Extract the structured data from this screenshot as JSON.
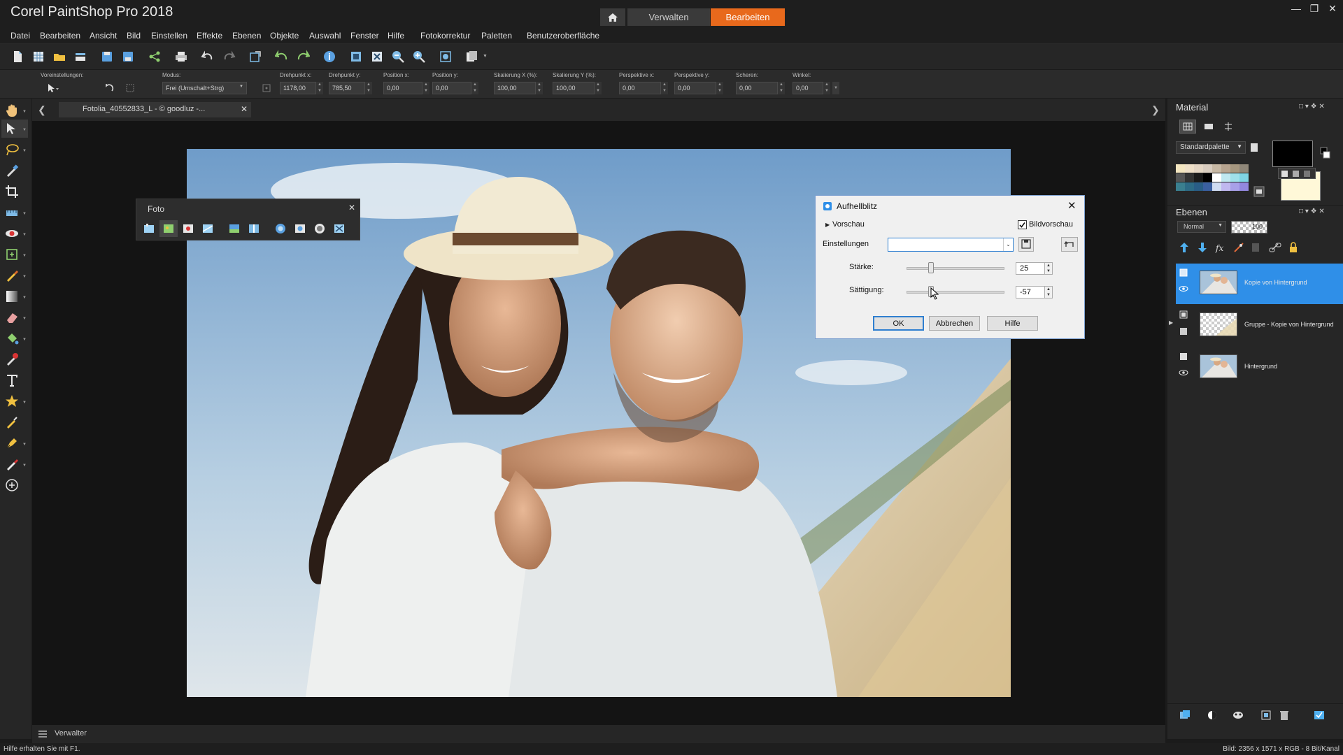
{
  "app": {
    "title": "Corel PaintShop Pro 2018",
    "tabs": {
      "manage": "Verwalten",
      "edit": "Bearbeiten"
    }
  },
  "menu": [
    "Datei",
    "Bearbeiten",
    "Ansicht",
    "Bild",
    "Einstellen",
    "Effekte",
    "Ebenen",
    "Objekte",
    "Auswahl",
    "Fenster",
    "Hilfe",
    "Fotokorrektur",
    "Paletten",
    "Benutzeroberfläche"
  ],
  "options": {
    "presets_label": "Voreinstellungen:",
    "mode_label": "Modus:",
    "mode_value": "Frei (Umschalt+Strg)",
    "pivot_x_label": "Drehpunkt x:",
    "pivot_x_value": "1178,00",
    "pivot_y_label": "Drehpunkt y:",
    "pivot_y_value": "785,50",
    "pos_x_label": "Position x:",
    "pos_x_value": "0,00",
    "pos_y_label": "Position y:",
    "pos_y_value": "0,00",
    "scale_x_label": "Skalierung X (%):",
    "scale_x_value": "100,00",
    "scale_y_label": "Skalierung Y (%):",
    "scale_y_value": "100,00",
    "persp_x_label": "Perspektive x:",
    "persp_x_value": "0,00",
    "persp_y_label": "Perspektive y:",
    "persp_y_value": "0,00",
    "shear_label": "Scheren:",
    "shear_value": "0,00",
    "angle_label": "Winkel:",
    "angle_value": "0,00"
  },
  "document": {
    "tab_title": "Fotolia_40552833_L - © goodluz -..."
  },
  "foto_palette": {
    "title": "Foto"
  },
  "dialog": {
    "title": "Aufhellblitz",
    "preview_label": "Vorschau",
    "image_preview_label": "Bildvorschau",
    "image_preview_checked": true,
    "settings_label": "Einstellungen",
    "settings_value": "",
    "strength_label": "Stärke:",
    "strength_value": "25",
    "saturation_label": "Sättigung:",
    "saturation_value": "-57",
    "ok": "OK",
    "cancel": "Abbrechen",
    "help": "Hilfe"
  },
  "material_panel": {
    "title": "Material",
    "palette_select": "Standardpalette",
    "foreground_color": "#000000",
    "background_color": "#fff8d8"
  },
  "layers_panel": {
    "title": "Ebenen",
    "blend_mode": "Normal",
    "opacity": "100",
    "layers": [
      {
        "name": "Kopie von Hintergrund",
        "selected": true
      },
      {
        "name": "Gruppe - Kopie von Hintergrund",
        "selected": false
      },
      {
        "name": "Hintergrund",
        "selected": false
      }
    ]
  },
  "bottom": {
    "organizer_label": "Verwalter"
  },
  "status": {
    "help_text": "Hilfe erhalten Sie mit F1.",
    "image_info": "Bild: 2356 x 1571 x RGB - 8 Bit/Kanal"
  },
  "colors": {
    "accent": "#e8691c",
    "selection": "#2f8fe8"
  }
}
